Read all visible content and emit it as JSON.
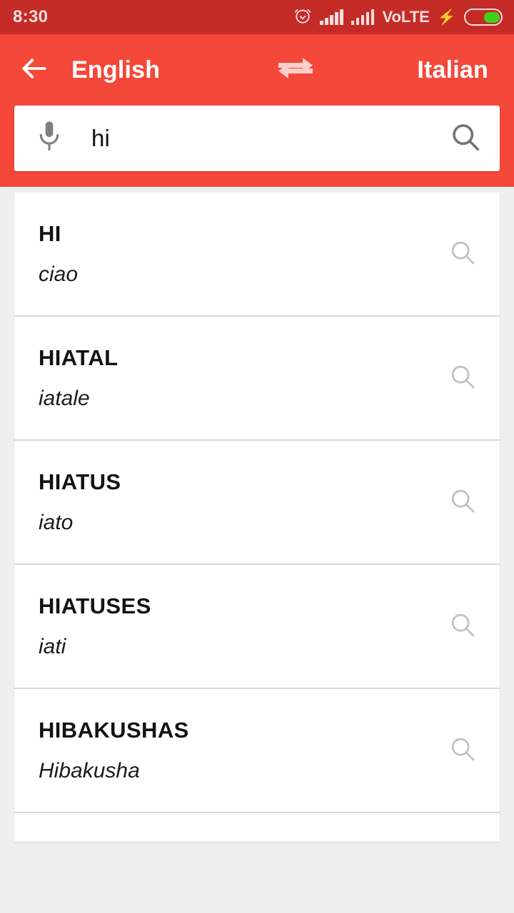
{
  "status_bar": {
    "time": "8:30",
    "volte_label": "VoLTE",
    "icons": [
      "alarm-icon",
      "signal-icon",
      "signal-icon",
      "volte-label",
      "charging-bolt-icon",
      "battery-icon"
    ],
    "battery_color": "#3fd21a",
    "background_color": "#c52b26"
  },
  "app_bar": {
    "back_label": "back-arrow-icon",
    "source_language": "English",
    "swap_label": "swap-languages-icon",
    "target_language": "Italian",
    "background_color": "#f4483a"
  },
  "search": {
    "value": "hi",
    "placeholder": "Search",
    "mic_label": "microphone-icon",
    "submit_label": "search-icon"
  },
  "results": [
    {
      "term": "HI",
      "translation": "ciao"
    },
    {
      "term": "HIATAL",
      "translation": "iatale"
    },
    {
      "term": "HIATUS",
      "translation": "iato"
    },
    {
      "term": "HIATUSES",
      "translation": "iati"
    },
    {
      "term": "HIBAKUSHAS",
      "translation": "Hibakusha"
    },
    {
      "term": "",
      "translation": ""
    }
  ]
}
